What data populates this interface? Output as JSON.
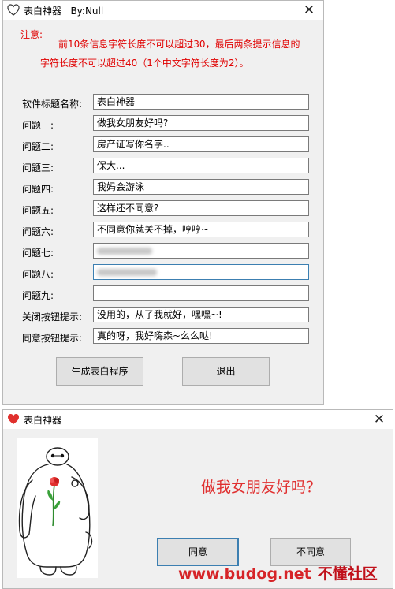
{
  "generator": {
    "title": "表白神器   By:Null",
    "close_glyph": "✕",
    "notice": {
      "label": "注意:",
      "line1": "前10条信息字符长度不可以超过30，最后两条提示信息的",
      "line2": "字符长度不可以超过40（1个中文字符长度为2）。"
    },
    "fields": [
      {
        "label": "软件标题名称:",
        "value": "表白神器"
      },
      {
        "label": "问题一:",
        "value": "做我女朋友好吗?"
      },
      {
        "label": "问题二:",
        "value": "房产证写你名字.."
      },
      {
        "label": "问题三:",
        "value": "保大..."
      },
      {
        "label": "问题四:",
        "value": "我妈会游泳"
      },
      {
        "label": "问题五:",
        "value": "这样还不同意?"
      },
      {
        "label": "问题六:",
        "value": "不同意你就关不掉，哼哼~"
      },
      {
        "label": "问题七:",
        "value": ""
      },
      {
        "label": "问题八:",
        "value": ""
      },
      {
        "label": "问题九:",
        "value": ""
      },
      {
        "label": "关闭按钮提示:",
        "value": "没用的，从了我就好，嘿嘿~!"
      },
      {
        "label": "同意按钮提示:",
        "value": "真的呀，我好嗨森~么么哒!"
      }
    ],
    "buttons": {
      "generate": "生成表白程序",
      "exit": "退出"
    }
  },
  "preview": {
    "title": "表白神器",
    "close_glyph": "✕",
    "question": "做我女朋友好吗？",
    "buttons": {
      "agree": "同意",
      "disagree": "不同意"
    }
  },
  "watermark": {
    "url": "www.budog.net",
    "name": "不懂社区"
  },
  "colors": {
    "notice": "#e00000",
    "question": "#e03030",
    "heart": "#e0302d",
    "watermark": "#d62428"
  }
}
